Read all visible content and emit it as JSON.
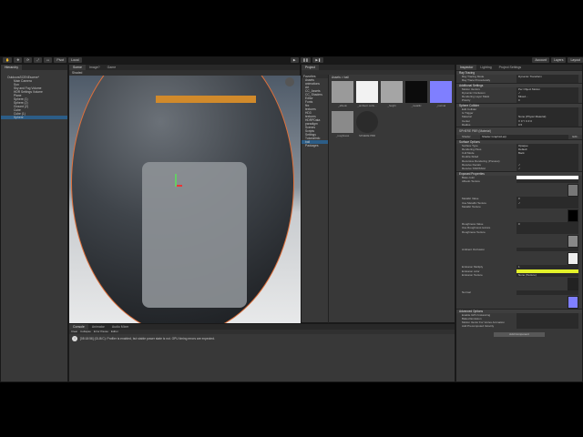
{
  "toolbar": {
    "pivot": "Pivot",
    "local": "Local",
    "account": "Account",
    "layers": "Layers",
    "layout": "Layout"
  },
  "hierarchy": {
    "tab": "Hierarchy",
    "items": [
      {
        "label": "OutdoorsSCENEscene*",
        "indent": 1,
        "selected": false
      },
      {
        "label": "Main Camera",
        "indent": 2,
        "selected": false
      },
      {
        "label": "Sun",
        "indent": 2,
        "selected": false
      },
      {
        "label": "Sky and Fog Volume",
        "indent": 2,
        "selected": false
      },
      {
        "label": "HDR Settings Volume",
        "indent": 2,
        "selected": false
      },
      {
        "label": "Plane",
        "indent": 2,
        "selected": false
      },
      {
        "label": "Sphere (1)",
        "indent": 2,
        "selected": false
      },
      {
        "label": "Sphere (2)",
        "indent": 2,
        "selected": false
      },
      {
        "label": "Ground (2)",
        "indent": 2,
        "selected": false
      },
      {
        "label": "Cube",
        "indent": 2,
        "selected": false
      },
      {
        "label": "Cube (1)",
        "indent": 2,
        "selected": false
      },
      {
        "label": "Sphere",
        "indent": 2,
        "selected": true
      }
    ]
  },
  "scene": {
    "tabs": [
      "Scene",
      "Image?",
      "Game"
    ],
    "shading": "Shaded"
  },
  "project": {
    "tab": "Project",
    "favorites": "Favorites",
    "breadcrumb": "Assets > ball",
    "tree": [
      "Assets",
      "animations",
      "Art",
      "CC_Assets",
      "CC_Shaders",
      "Editor",
      "Fonts",
      "fbx",
      "textures",
      "HD3",
      "textures",
      "HDRPData",
      "paradigm",
      "Scenes",
      "Scripts",
      "Settings",
      "TutorialInfo",
      "ball",
      "Packages"
    ],
    "thumbs": [
      {
        "label": "_albedo",
        "c": "#9a9a9a"
      },
      {
        "label": "_ambient occlu...",
        "c": "#f2f2f2"
      },
      {
        "label": "_height",
        "c": "#a5a5a5"
      },
      {
        "label": "_metallic",
        "c": "#0c0c0c"
      },
      {
        "label": "_normal",
        "c": "#7f7fff"
      },
      {
        "label": "_roughness",
        "c": "#8a8a8a"
      },
      {
        "label": "SPHERE PBR",
        "c": "#2b2b2b"
      }
    ]
  },
  "console": {
    "tabs": [
      "Console",
      "Animator",
      "Audio Mixer"
    ],
    "controls": [
      "Clear",
      "Collapse",
      "Error Pause",
      "Editor"
    ],
    "message": "[08:18:56] (GLB/C): Profiler is enabled, but stable power state is not. GPU timing errors are expected."
  },
  "inspector": {
    "tabs": [
      "Inspector",
      "Lighting",
      "Project Settings"
    ],
    "raytracing": {
      "title": "Ray Tracing",
      "rows": [
        [
          "Ray Tracing Mode",
          "Dynamic Transform"
        ],
        [
          "Ray Trace Procedurally",
          ""
        ]
      ]
    },
    "additional": {
      "title": "Additional Settings",
      "rows": [
        [
          "Motion Vectors",
          "Per Object Motion"
        ],
        [
          "Dynamic Occlusion",
          "✓"
        ],
        [
          "Rendering Layer Mask",
          "Mixed..."
        ],
        [
          "Priority",
          "0"
        ]
      ]
    },
    "collider": {
      "title": "Sphere Collider",
      "rows": [
        [
          "Edit Collider",
          ""
        ],
        [
          "Is Trigger",
          ""
        ],
        [
          "Material",
          "None (Physic Material)"
        ],
        [
          "Center",
          "X 0   Y 0   Z 0"
        ],
        [
          "Radius",
          "0.5"
        ]
      ]
    },
    "material": {
      "name": "SPHERE PBR (Material)",
      "shader_label": "Shader",
      "shader": "Shader Graphs/Lerp",
      "edit": "Edit..."
    },
    "surface": {
      "title": "Surface Options",
      "rows": [
        [
          "Surface Type",
          "Opaque"
        ],
        [
          "Rendering Pass",
          "Default"
        ],
        [
          "Cull Mode",
          "Back"
        ],
        [
          "Double-Sided",
          ""
        ],
        [
          "Recursive Rendering (Preview)",
          ""
        ],
        [
          "Receive Decals",
          "✓"
        ],
        [
          "Receive SSR/SSGI",
          "✓"
        ]
      ]
    },
    "exposed": {
      "title": "Exposed Properties",
      "rows": [
        [
          "Base color",
          ""
        ],
        [
          "Albedo Texture",
          ""
        ],
        [
          "Metallic Value",
          "0"
        ],
        [
          "Use Metallic Texture",
          "✓"
        ],
        [
          "Metallic Texture",
          ""
        ],
        [
          "Roughness Value",
          "0"
        ],
        [
          "Use Roughness texture",
          ""
        ],
        [
          "Roughness Texture",
          ""
        ],
        [
          "Ambient Occlusion",
          ""
        ],
        [
          "Emission Multiply",
          "1"
        ],
        [
          "Emission color",
          ""
        ],
        [
          "Emission Texture",
          "None (Texture)"
        ],
        [
          "Normal",
          ""
        ]
      ]
    },
    "advanced": {
      "title": "Advanced Options",
      "rows": [
        [
          "Enable GPU Instancing",
          ""
        ],
        [
          "Baked Emission",
          ""
        ],
        [
          "Motion Vector For Vertex Animation",
          ""
        ],
        [
          "Add Precomputed Velocity",
          ""
        ]
      ]
    },
    "add_component": "Add Component",
    "roughness_value": 0,
    "colors": {
      "emission": "#e3f22a",
      "base": "#ffffff"
    }
  }
}
